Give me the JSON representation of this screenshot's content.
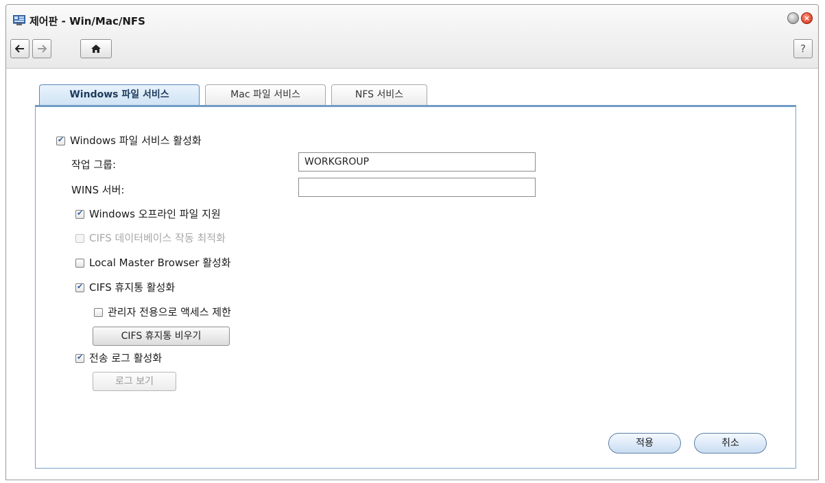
{
  "window": {
    "title": "제어판 - Win/Mac/NFS",
    "help_label": "?"
  },
  "tabs": [
    {
      "label": "Windows 파일 서비스"
    },
    {
      "label": "Mac 파일 서비스"
    },
    {
      "label": "NFS 서비스"
    }
  ],
  "form": {
    "enable_windows": {
      "label": "Windows 파일 서비스 활성화",
      "checked": true
    },
    "workgroup": {
      "label": "작업 그룹:",
      "value": "WORKGROUP"
    },
    "wins": {
      "label": "WINS 서버:",
      "value": ""
    },
    "offline_files": {
      "label": "Windows 오프라인 파일 지원",
      "checked": true
    },
    "cifs_db_opt": {
      "label": "CIFS 데이터베이스 작동 최적화",
      "checked": false,
      "disabled": true
    },
    "local_master": {
      "label": "Local Master Browser 활성화",
      "checked": false
    },
    "cifs_recycle": {
      "label": "CIFS 휴지통 활성화",
      "checked": true
    },
    "admin_only": {
      "label": "관리자 전용으로 액세스 제한",
      "checked": false
    },
    "empty_recycle_button": "CIFS 휴지통 비우기",
    "transfer_log": {
      "label": "전송 로그 활성화",
      "checked": true
    },
    "view_log_button": "로그 보기"
  },
  "footer": {
    "apply_label": "적용",
    "cancel_label": "취소"
  },
  "colors": {
    "accent_blue": "#6e9bc5",
    "close_red": "#cc2a10"
  }
}
